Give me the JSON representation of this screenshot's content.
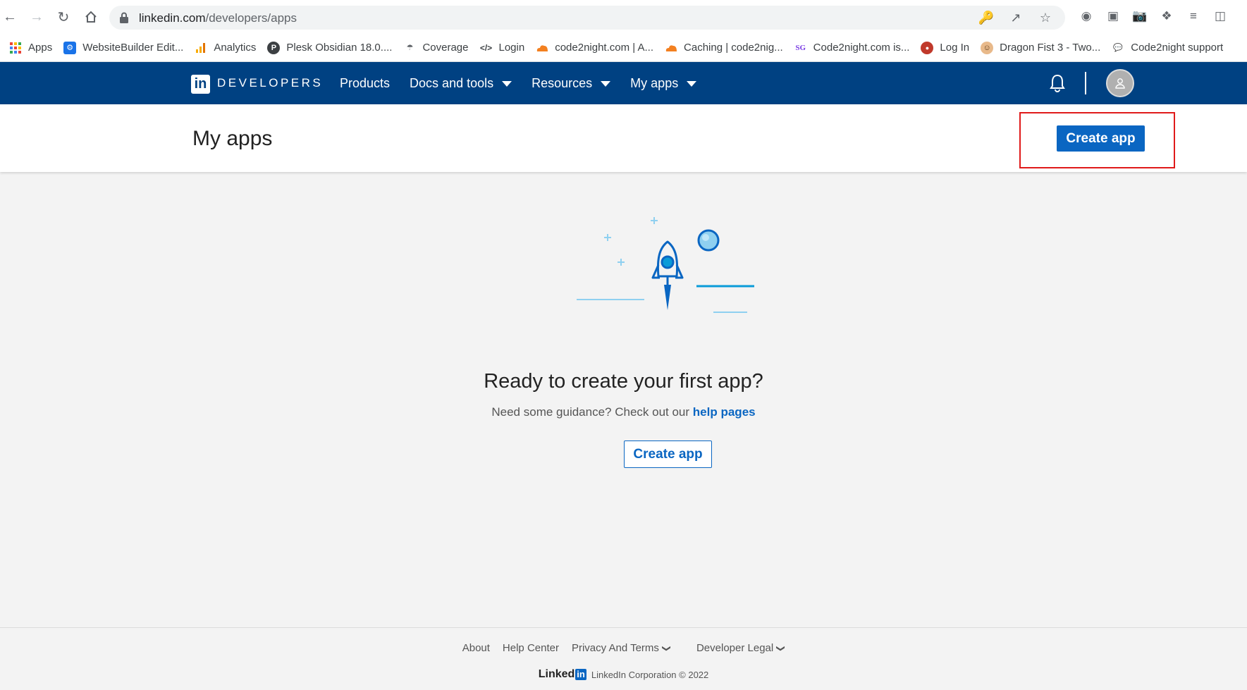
{
  "browser": {
    "url_host": "linkedin.com",
    "url_path": "/developers/apps",
    "bookmarks": [
      {
        "label": "Apps",
        "icon": "apps-grid-icon"
      },
      {
        "label": "WebsiteBuilder Edit...",
        "icon": "gear-icon"
      },
      {
        "label": "Analytics",
        "icon": "analytics-icon"
      },
      {
        "label": "Plesk Obsidian 18.0....",
        "icon": "plesk-icon"
      },
      {
        "label": "Coverage",
        "icon": "coverage-icon"
      },
      {
        "label": "Login",
        "icon": "code-icon"
      },
      {
        "label": "code2night.com | A...",
        "icon": "cloudflare-icon"
      },
      {
        "label": "Caching | code2nig...",
        "icon": "cloudflare-icon"
      },
      {
        "label": "Code2night.com is...",
        "icon": "sg-icon"
      },
      {
        "label": "Log In",
        "icon": "login-icon"
      },
      {
        "label": "Dragon Fist 3 - Two...",
        "icon": "dragon-icon"
      },
      {
        "label": "Code2night support",
        "icon": "chat-icon"
      }
    ]
  },
  "header": {
    "logo_text": "in",
    "brand": "DEVELOPERS",
    "nav": [
      {
        "label": "Products",
        "has_dropdown": false
      },
      {
        "label": "Docs and tools",
        "has_dropdown": true
      },
      {
        "label": "Resources",
        "has_dropdown": true
      },
      {
        "label": "My apps",
        "has_dropdown": true
      }
    ]
  },
  "page": {
    "title": "My apps",
    "create_button": "Create app"
  },
  "empty_state": {
    "heading": "Ready to create your first app?",
    "guidance_text": "Need some guidance? Check out our",
    "help_link": "help pages",
    "create_button": "Create app"
  },
  "footer": {
    "links": [
      "About",
      "Help Center",
      "Privacy And Terms",
      "Developer Legal"
    ],
    "wordmark_text": "Linked",
    "wordmark_in": "in",
    "copyright": "LinkedIn Corporation © 2022"
  },
  "colors": {
    "header_bg": "#004182",
    "primary": "#0a66c2",
    "highlight": "#e01a1a"
  }
}
